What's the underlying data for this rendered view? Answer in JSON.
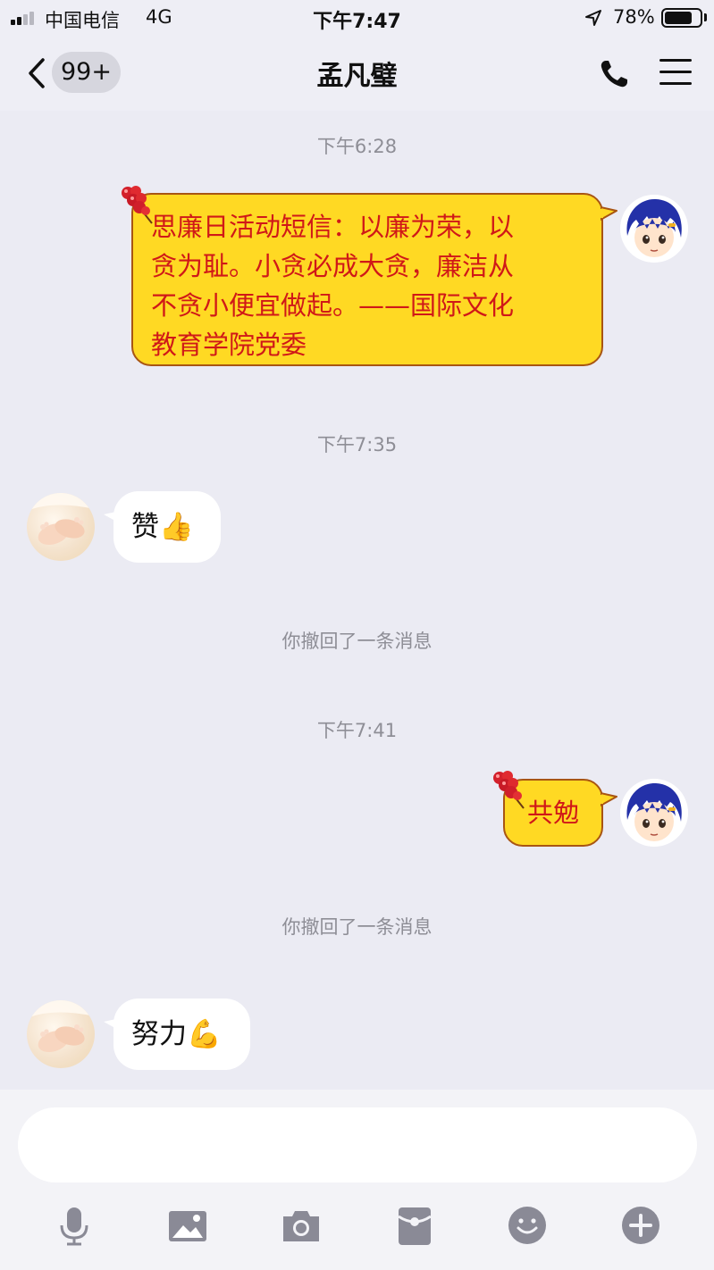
{
  "status_bar": {
    "carrier": "中国电信",
    "network": "4G",
    "time": "下午7:47",
    "battery_percent": "78%",
    "battery_level": 0.78,
    "signal_bars": 2
  },
  "nav": {
    "unread_count": "99+",
    "title": "孟凡璧"
  },
  "messages": [
    {
      "type": "timestamp",
      "text": "下午6:28"
    },
    {
      "type": "outgoing",
      "text": "思廉日活动短信：以廉为荣，以贪为耻。小贪必成大贪，廉洁从不贪小便宜做起。——国际文化教育学院党委",
      "lines": [
        "思廉日活动短信：以廉为荣，以",
        "贪为耻。小贪必成大贪，廉洁从",
        "不贪小便宜做起。——国际文化",
        "教育学院党委"
      ]
    },
    {
      "type": "timestamp",
      "text": "下午7:35"
    },
    {
      "type": "incoming",
      "text": "赞👍"
    },
    {
      "type": "system",
      "text": "你撤回了一条消息"
    },
    {
      "type": "timestamp",
      "text": "下午7:41"
    },
    {
      "type": "outgoing",
      "text": "共勉"
    },
    {
      "type": "system",
      "text": "你撤回了一条消息"
    },
    {
      "type": "incoming",
      "text": "努力💪"
    }
  ],
  "input": {
    "value": "",
    "placeholder": ""
  },
  "toolbar": {
    "items": [
      "voice-icon",
      "image-icon",
      "camera-icon",
      "red-packet-icon",
      "emoji-icon",
      "plus-icon"
    ]
  },
  "colors": {
    "bubble_outgoing": "#ffd923",
    "bubble_outgoing_text": "#d01818",
    "bubble_outgoing_border": "#a85512",
    "bubble_incoming": "#ffffff",
    "background": "#ebebf3",
    "toolbar_icon": "#8a8a96"
  }
}
